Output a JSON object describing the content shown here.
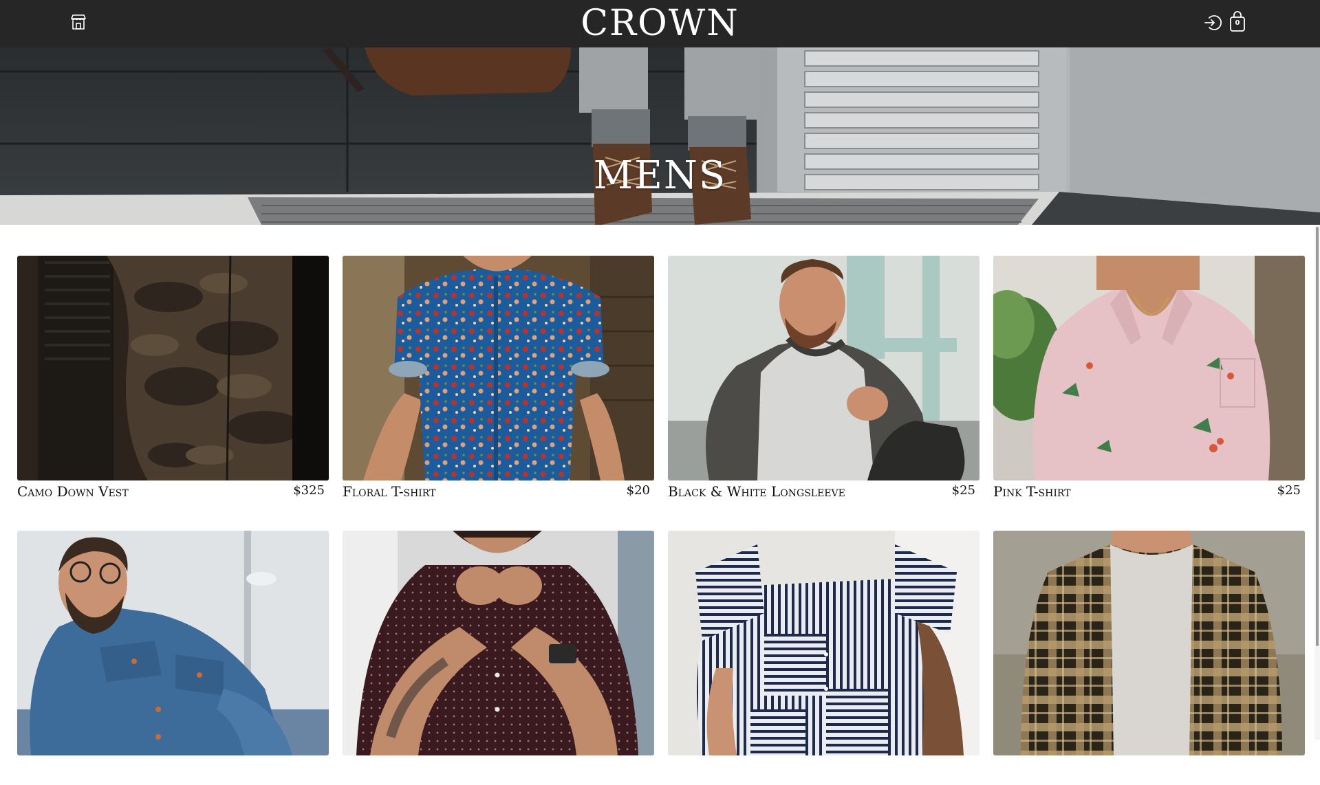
{
  "nav": {
    "logo": "CROWN",
    "cart_count": "0",
    "icons": {
      "store": "store-icon",
      "login": "sign-in-icon",
      "cart": "shopping-bag-icon"
    },
    "bg_color": "#262626"
  },
  "hero": {
    "title": "MENS"
  },
  "products": [
    {
      "name": "Camo Down Vest",
      "price": "$325"
    },
    {
      "name": "Floral T-shirt",
      "price": "$20"
    },
    {
      "name": "Black & White Longsleeve",
      "price": "$25"
    },
    {
      "name": "Pink T-shirt",
      "price": "$25"
    },
    {
      "name": "",
      "price": ""
    },
    {
      "name": "",
      "price": ""
    },
    {
      "name": "",
      "price": ""
    },
    {
      "name": "",
      "price": ""
    }
  ]
}
